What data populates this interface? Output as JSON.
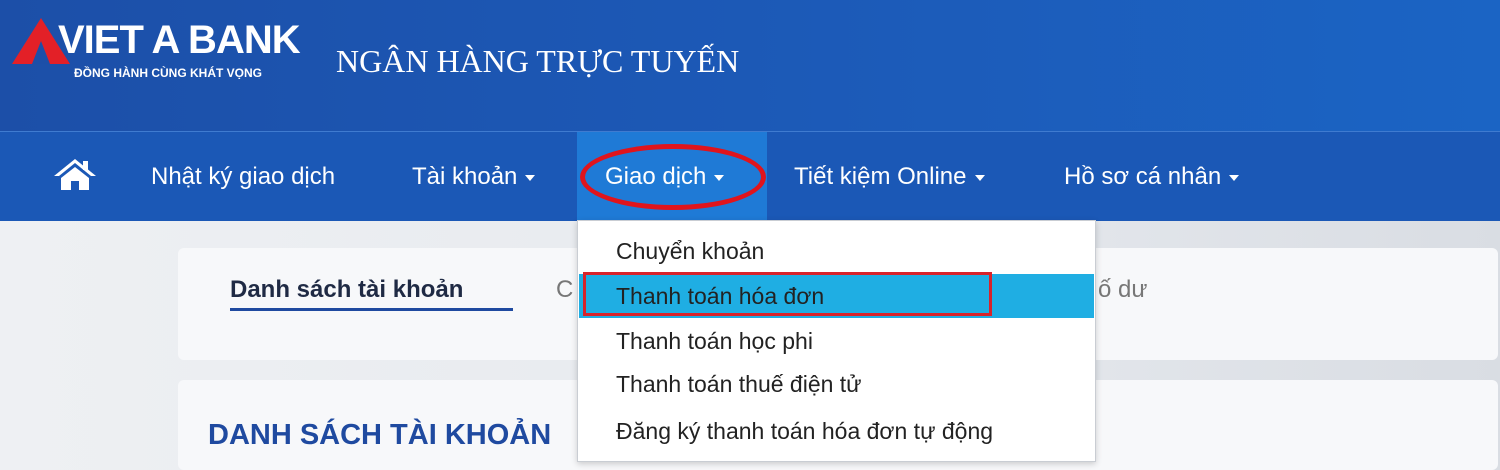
{
  "header": {
    "logo_name": "VIET A BANK",
    "logo_tagline": "ĐỒNG HÀNH CÙNG KHÁT VỌNG",
    "site_title": "NGÂN HÀNG TRỰC TUYẾN"
  },
  "nav": {
    "home_icon": "home-icon",
    "items": [
      {
        "label": "Nhật ký giao dịch",
        "has_caret": false
      },
      {
        "label": "Tài khoản",
        "has_caret": true
      },
      {
        "label": "Giao dịch",
        "has_caret": true,
        "active": true
      },
      {
        "label": "Tiết kiệm Online",
        "has_caret": true
      },
      {
        "label": "Hồ sơ cá nhân",
        "has_caret": true
      }
    ]
  },
  "dropdown": {
    "items": [
      {
        "label": "Chuyển khoản"
      },
      {
        "label": "Thanh toán hóa đơn",
        "active": true
      },
      {
        "label": "Thanh toán học phi"
      },
      {
        "label": "Thanh toán thuế điện tử"
      },
      {
        "label": "Đăng ký thanh toán hóa đơn tự động"
      }
    ]
  },
  "tabs": {
    "active_label": "Danh sách tài khoản",
    "partial_left": "C",
    "partial_right": "ố dư"
  },
  "section": {
    "title": "DANH SÁCH TÀI KHOẢN"
  },
  "colors": {
    "header_blue": "#1c4fa8",
    "nav_blue": "#1b58b6",
    "active_nav": "#1f7ad6",
    "dropdown_active": "#1faee3",
    "highlight_red": "#e0141c",
    "logo_red": "#e32027"
  }
}
